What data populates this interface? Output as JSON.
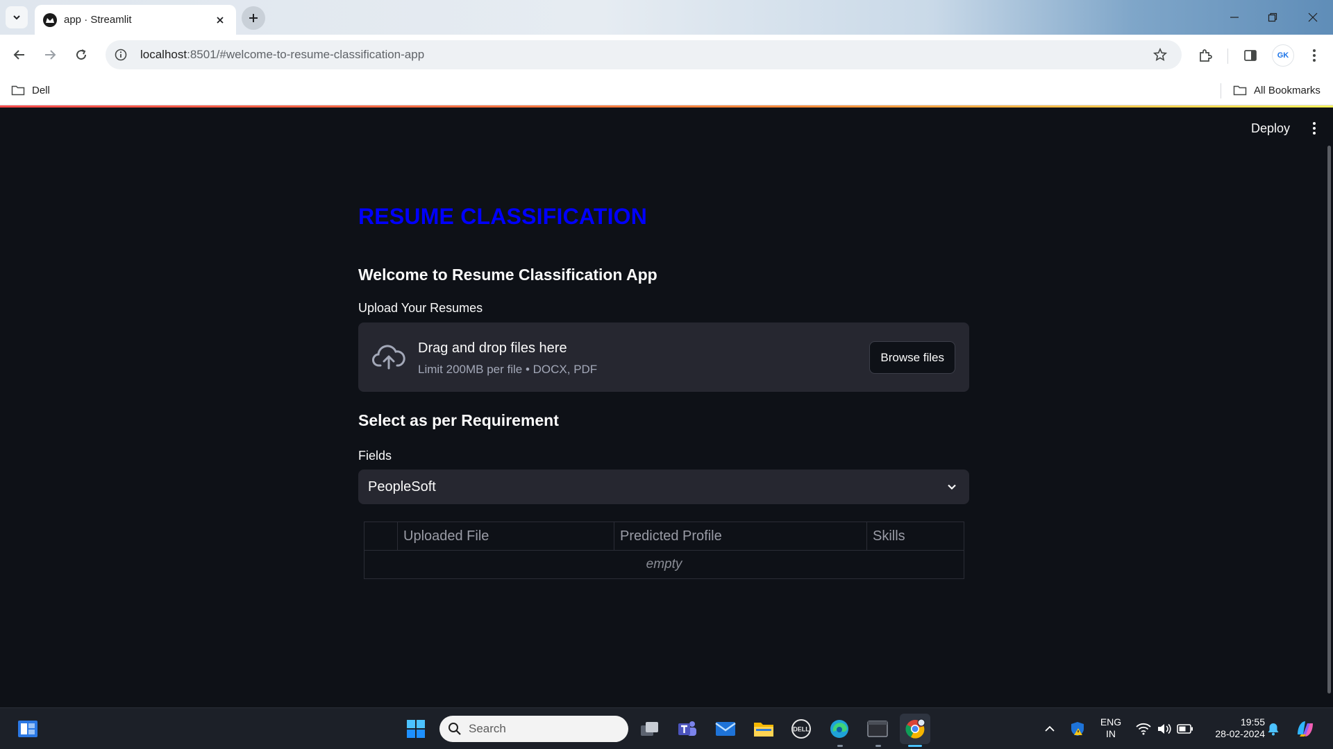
{
  "browser": {
    "tab_title": "app · Streamlit",
    "url_host": "localhost",
    "url_path": ":8501/#welcome-to-resume-classification-app",
    "bookmarks": {
      "left": "Dell",
      "right": "All Bookmarks"
    },
    "profile_initials": "GK"
  },
  "app": {
    "deploy_label": "Deploy",
    "title": "RESUME CLASSIFICATION",
    "title_color": "#0000ff",
    "welcome_heading": "Welcome to Resume Classification App",
    "uploader": {
      "label": "Upload Your Resumes",
      "drop_text": "Drag and drop files here",
      "limit_text": "Limit 200MB per file • DOCX, PDF",
      "browse_label": "Browse files"
    },
    "requirement_heading": "Select as per Requirement",
    "fields": {
      "label": "Fields",
      "selected": "PeopleSoft"
    },
    "table": {
      "columns": [
        "Uploaded File",
        "Predicted Profile",
        "Skills"
      ],
      "empty_text": "empty"
    }
  },
  "taskbar": {
    "search_placeholder": "Search",
    "language": "ENG",
    "region": "IN",
    "time": "19:55",
    "date": "28-02-2024"
  }
}
